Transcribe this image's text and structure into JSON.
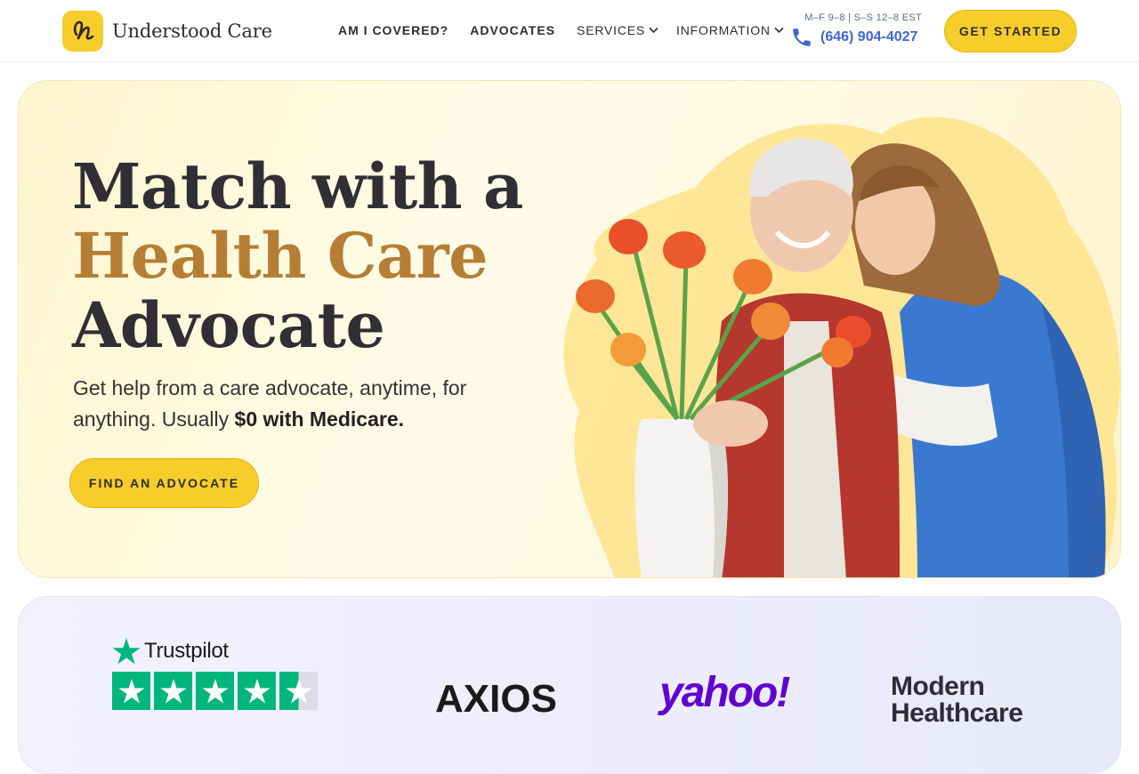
{
  "brand": {
    "name": "Understood Care",
    "accent": "#f7cd2b"
  },
  "nav": {
    "items": [
      {
        "label": "AM I COVERED?",
        "dropdown": false
      },
      {
        "label": "ADVOCATES",
        "dropdown": false
      },
      {
        "label": "SERVICES",
        "dropdown": true
      },
      {
        "label": "INFORMATION",
        "dropdown": true
      }
    ]
  },
  "contact": {
    "hours": "M–F 9–8 | S–S 12–8 EST",
    "phone": "(646) 904-4027"
  },
  "header_cta": "GET STARTED",
  "hero": {
    "line1": "Match with a",
    "line2": "Health Care",
    "line3": "Advocate",
    "subtext": "Get help from a care advocate, anytime, for anything. Usually ",
    "subtext_bold": "$0 with Medicare.",
    "cta": "FIND AN ADVOCATE",
    "accent_color": "#b57e34"
  },
  "press": {
    "trustpilot": "Trustpilot",
    "rating_stars": 4.5,
    "logos": [
      "AXIOS",
      "yahoo!",
      "Modern Healthcare"
    ]
  },
  "icons": [
    "logo-mark-icon",
    "phone-icon",
    "chevron-down-icon",
    "trustpilot-star-icon"
  ]
}
